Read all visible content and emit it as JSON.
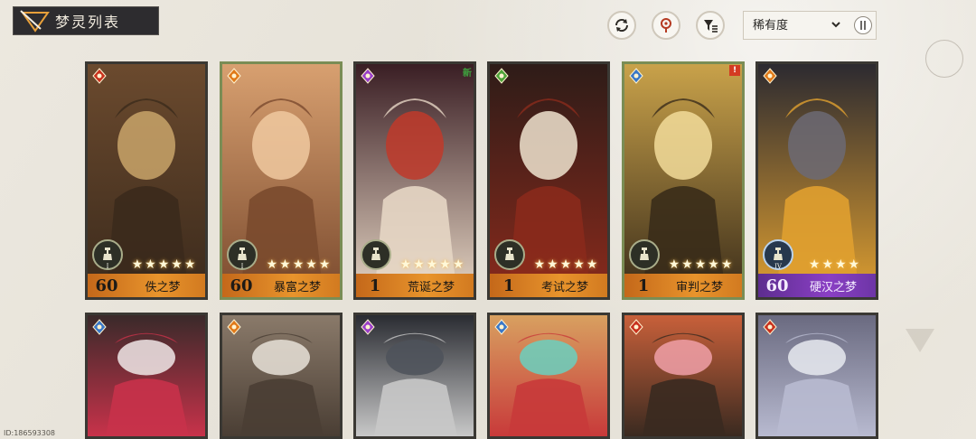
{
  "header": {
    "title": "梦灵列表"
  },
  "toolbar": {
    "refresh_icon": "refresh-icon",
    "locate_icon": "location-pin-icon",
    "filter_icon": "filter-icon",
    "sort": {
      "label": "稀有度"
    }
  },
  "cards_row1": [
    {
      "level": "60",
      "name": "佚之梦",
      "stars": "★★★★★",
      "rank": "I",
      "element": "red",
      "selected": false,
      "tag": ""
    },
    {
      "level": "60",
      "name": "暴富之梦",
      "stars": "★★★★★",
      "rank": "I",
      "element": "orange",
      "selected": true,
      "tag": ""
    },
    {
      "level": "1",
      "name": "荒诞之梦",
      "stars": "★★★★★",
      "rank": "",
      "element": "purple",
      "selected": false,
      "tag": "新"
    },
    {
      "level": "1",
      "name": "考试之梦",
      "stars": "★★★★★",
      "rank": "",
      "element": "green",
      "selected": false,
      "tag": ""
    },
    {
      "level": "1",
      "name": "审判之梦",
      "stars": "★★★★★",
      "rank": "",
      "element": "blue",
      "selected": true,
      "tag": "!"
    },
    {
      "level": "60",
      "name": "硬汉之梦",
      "stars": "★★★★",
      "rank": "IV",
      "element": "orange",
      "selected": false,
      "tag": ""
    }
  ],
  "cards_row2": [
    {
      "element": "blue"
    },
    {
      "element": "orange"
    },
    {
      "element": "purple"
    },
    {
      "element": "blue"
    },
    {
      "element": "red"
    },
    {
      "element": "red"
    }
  ],
  "footer": {
    "id_text": "ID:186593308"
  },
  "colors": {
    "gold_bar": "#e8942c",
    "purple_bar": "#8a3fc4",
    "selected_border": "#7a8d55",
    "card_border": "#3a3833"
  }
}
